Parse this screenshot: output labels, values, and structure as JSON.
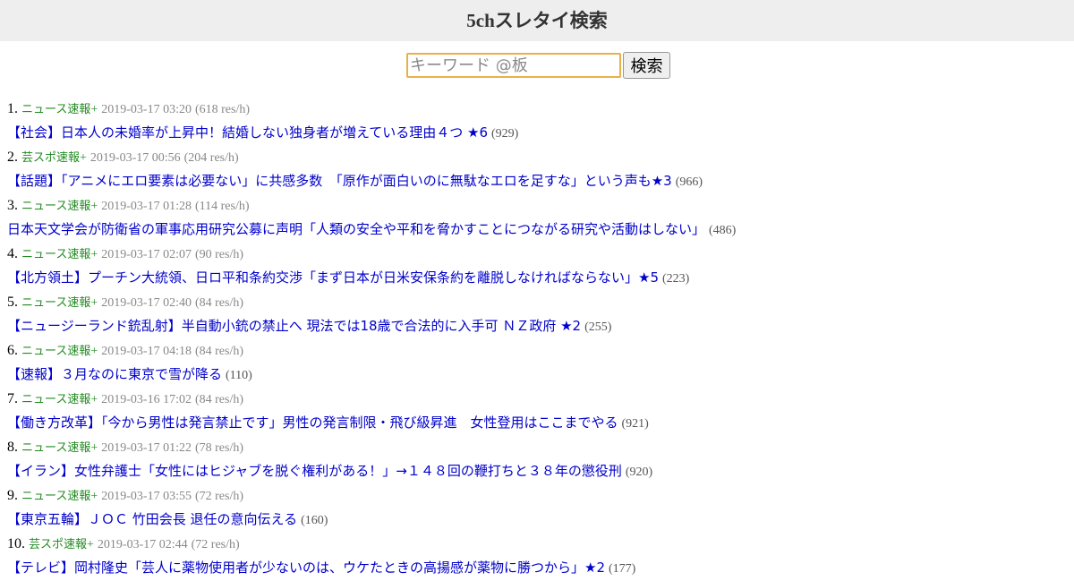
{
  "header": {
    "title": "5chスレタイ検索"
  },
  "search": {
    "placeholder": "キーワード @板",
    "button_label": "検索"
  },
  "results": [
    {
      "rank": "1.",
      "board": "ニュース速報",
      "plus": "+",
      "datetime": "2019-03-17 03:20",
      "speed": "(618 res/h)",
      "title": "【社会】日本人の未婚率が上昇中！結婚しない独身者が増えている理由４つ ★6",
      "count": "(929)"
    },
    {
      "rank": "2.",
      "board": "芸スポ速報",
      "plus": "+",
      "datetime": "2019-03-17 00:56",
      "speed": "(204 res/h)",
      "title": "【話題】「アニメにエロ要素は必要ない」に共感多数　「原作が面白いのに無駄なエロを足すな」という声も★3",
      "count": "(966)"
    },
    {
      "rank": "3.",
      "board": "ニュース速報",
      "plus": "+",
      "datetime": "2019-03-17 01:28",
      "speed": "(114 res/h)",
      "title": "日本天文学会が防衛省の軍事応用研究公募に声明「人類の安全や平和を脅かすことにつながる研究や活動はしない」",
      "count": "(486)"
    },
    {
      "rank": "4.",
      "board": "ニュース速報",
      "plus": "+",
      "datetime": "2019-03-17 02:07",
      "speed": "(90 res/h)",
      "title": "【北方領土】プーチン大統領、日ロ平和条約交渉「まず日本が日米安保条約を離脱しなければならない」★5",
      "count": "(223)"
    },
    {
      "rank": "5.",
      "board": "ニュース速報",
      "plus": "+",
      "datetime": "2019-03-17 02:40",
      "speed": "(84 res/h)",
      "title": "【ニュージーランド銃乱射】半自動小銃の禁止へ 現法では18歳で合法的に入手可 ＮＺ政府 ★2",
      "count": "(255)"
    },
    {
      "rank": "6.",
      "board": "ニュース速報",
      "plus": "+",
      "datetime": "2019-03-17 04:18",
      "speed": "(84 res/h)",
      "title": "【速報】３月なのに東京で雪が降る",
      "count": "(110)"
    },
    {
      "rank": "7.",
      "board": "ニュース速報",
      "plus": "+",
      "datetime": "2019-03-16 17:02",
      "speed": "(84 res/h)",
      "title": "【働き方改革】「今から男性は発言禁止です」男性の発言制限・飛び級昇進　女性登用はここまでやる",
      "count": "(921)"
    },
    {
      "rank": "8.",
      "board": "ニュース速報",
      "plus": "+",
      "datetime": "2019-03-17 01:22",
      "speed": "(78 res/h)",
      "title": "【イラン】女性弁護士「女性にはヒジャブを脱ぐ権利がある！」→１４８回の鞭打ちと３８年の懲役刑",
      "count": "(920)"
    },
    {
      "rank": "9.",
      "board": "ニュース速報",
      "plus": "+",
      "datetime": "2019-03-17 03:55",
      "speed": "(72 res/h)",
      "title": "【東京五輪】ＪＯＣ 竹田会長 退任の意向伝える",
      "count": "(160)"
    },
    {
      "rank": "10.",
      "board": "芸スポ速報",
      "plus": "+",
      "datetime": "2019-03-17 02:44",
      "speed": "(72 res/h)",
      "title": "【テレビ】岡村隆史「芸人に薬物使用者が少ないのは、ウケたときの高揚感が薬物に勝つから」★2",
      "count": "(177)"
    }
  ]
}
